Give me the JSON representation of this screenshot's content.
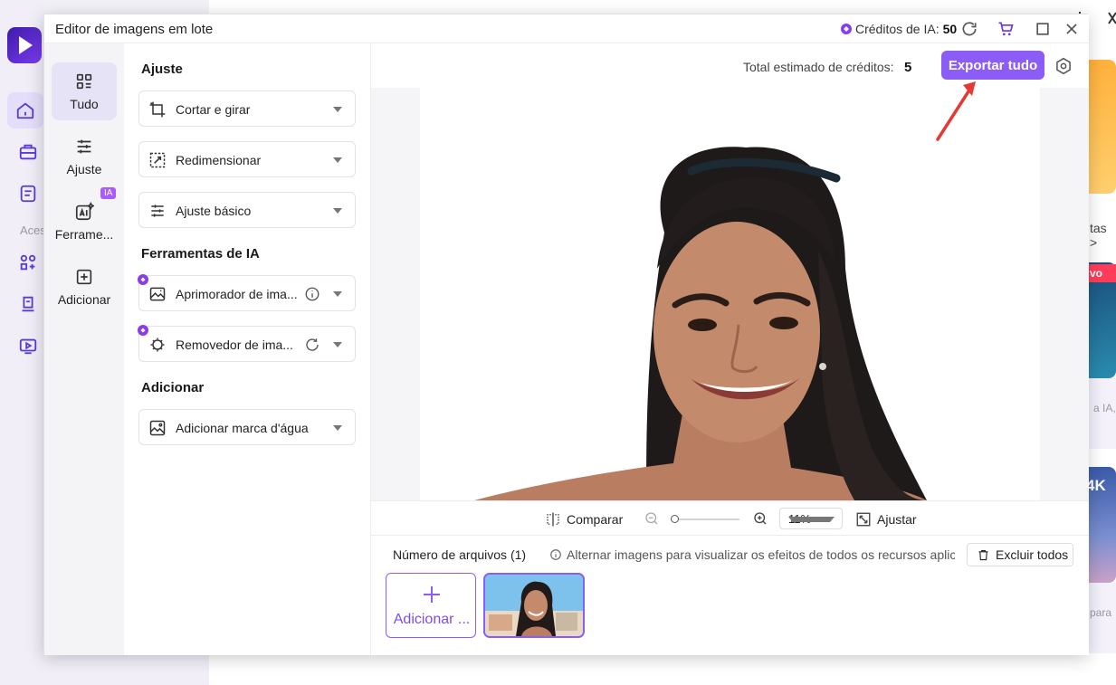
{
  "dialog": {
    "title": "Editor de imagens em lote",
    "credits_label": "Créditos de IA:",
    "credits_value": "50"
  },
  "rail": {
    "items": [
      {
        "label": "Tudo",
        "active": true
      },
      {
        "label": "Ajuste",
        "active": false
      },
      {
        "label": "Ferramentas de IA",
        "short": "Ferrame...",
        "badge": "IA",
        "active": false
      },
      {
        "label": "Adicionar",
        "active": false
      }
    ]
  },
  "panel": {
    "sections": [
      {
        "title": "Ajuste",
        "items": [
          "Cortar e girar",
          "Redimensionar",
          "Ajuste básico"
        ]
      },
      {
        "title": "Ferramentas de IA",
        "items": [
          "Aprimorador de ima...",
          "Removedor de ima..."
        ]
      },
      {
        "title": "Adicionar",
        "items": [
          "Adicionar marca d'água"
        ]
      }
    ]
  },
  "topbar": {
    "estimate_label": "Total estimado de créditos:",
    "estimate_value": "5",
    "export_label": "Exportar tudo"
  },
  "zoombar": {
    "compare_label": "Comparar",
    "zoom_value": "11%",
    "fit_label": "Ajustar"
  },
  "files": {
    "count_label": "Número de arquivos (1)",
    "hint": "Alternar imagens para visualizar os efeitos de todos os recursos aplic...",
    "delete_all": "Excluir todos",
    "add_label": "Adicionar ..."
  },
  "background": {
    "aces": "Aces",
    "tas": "tas >",
    "novo": "vo",
    "ia": "a IA,",
    "k4": "4K",
    "para": "para"
  },
  "colors": {
    "accent": "#8b5cf6",
    "annotation": "#e53935"
  }
}
